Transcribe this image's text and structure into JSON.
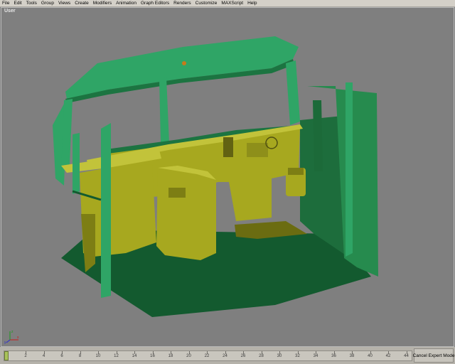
{
  "menu": [
    "File",
    "Edit",
    "Tools",
    "Group",
    "Views",
    "Create",
    "Modifiers",
    "Animation",
    "Graph Editors",
    "Renders",
    "Customize",
    "MAXScript",
    "Help"
  ],
  "viewport": {
    "label": "User"
  },
  "axis_labels": {
    "x": "x",
    "y": "y",
    "z": "z"
  },
  "timeline": {
    "ticks": [
      "2",
      "4",
      "6",
      "8",
      "10",
      "12",
      "14",
      "16",
      "18",
      "20",
      "22",
      "24",
      "26",
      "28",
      "30",
      "32",
      "34",
      "36",
      "38",
      "40",
      "42",
      "44"
    ],
    "expert_button": "Cancel Expert Mode"
  },
  "colors": {
    "green": "#2fa566",
    "dark_green": "#135a2f",
    "yellow": "#a7a81f",
    "viewport_bg": "#7f7f7f"
  }
}
